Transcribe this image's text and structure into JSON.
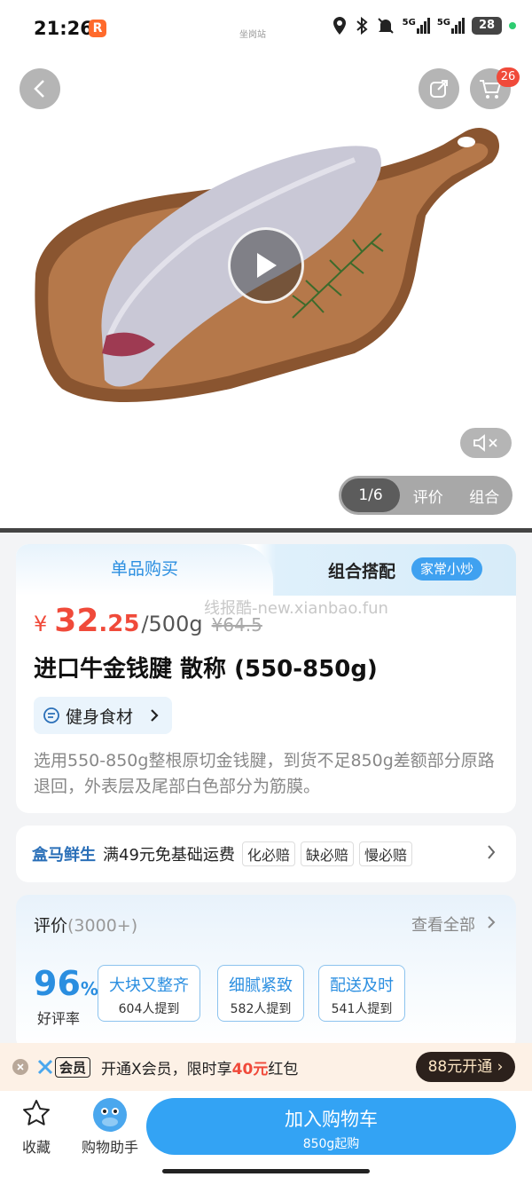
{
  "status_bar": {
    "time": "21:26",
    "app_badge": "R",
    "center_text": "坐岗站",
    "network_1": "5G",
    "network_2": "5G",
    "battery": "28"
  },
  "hero": {
    "cart_count": "26",
    "pager_current": "1/6",
    "pager_tabs": [
      "评价",
      "组合"
    ]
  },
  "tabs": {
    "single": "单品购买",
    "combo": "组合搭配",
    "combo_tag": "家常小炒"
  },
  "product": {
    "price_symbol": "¥",
    "price_int": "32",
    "price_dec": ".25",
    "price_unit": "/500g",
    "price_old": "¥64.5",
    "watermark": "线报酷-new.xianbao.fun",
    "title": "进口牛金钱腱 散称 (550-850g)",
    "tag": "健身食材",
    "description": "选用550-850g整根原切金钱腱，到货不足850g差额部分原路退回，外表层及尾部白色部分为筋膜。"
  },
  "shipping": {
    "brand": "盒马鲜生",
    "text": "满49元免基础运费",
    "tags": [
      "化必赔",
      "缺必赔",
      "慢必赔"
    ]
  },
  "reviews": {
    "title": "评价",
    "count": "(3000+)",
    "view_all": "查看全部",
    "score": "96",
    "score_unit": "%",
    "score_label": "好评率",
    "keywords": [
      {
        "title": "大块又整齐",
        "count": "604人提到"
      },
      {
        "title": "细腻紧致",
        "count": "582人提到"
      },
      {
        "title": "配送及时",
        "count": "541人提到"
      }
    ]
  },
  "vip": {
    "logo_text": "会员",
    "text_prefix": "开通X会员，限时享",
    "amount": "40元",
    "text_suffix": "红包",
    "button": "88元开通 ›"
  },
  "bottom": {
    "favorite": "收藏",
    "assistant": "购物助手",
    "add_cart": "加入购物车",
    "add_cart_sub": "850g起购"
  },
  "colors": {
    "accent_blue": "#33a3f4",
    "price_red": "#f04a3a",
    "vip_dark": "#2c211c"
  }
}
